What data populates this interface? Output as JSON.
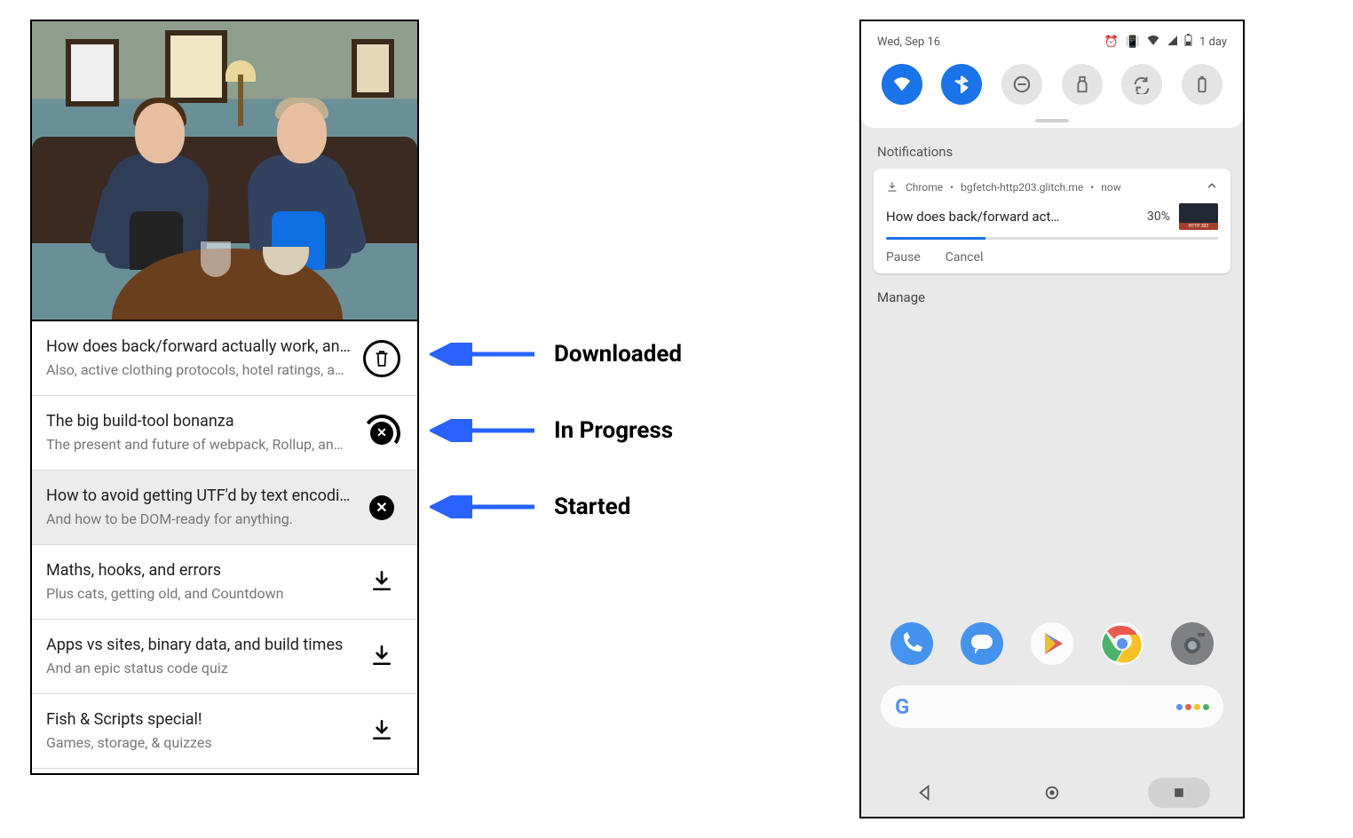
{
  "annotations": {
    "downloaded": "Downloaded",
    "in_progress": "In Progress",
    "started": "Started"
  },
  "episodes": [
    {
      "title": "How does back/forward actually work, an…",
      "subtitle": "Also, active clothing protocols, hotel ratings, a…",
      "state": "downloaded",
      "highlight": false
    },
    {
      "title": "The big build-tool bonanza",
      "subtitle": "The present and future of webpack, Rollup, an…",
      "state": "in_progress",
      "highlight": false
    },
    {
      "title": "How to avoid getting UTF'd by text encodi…",
      "subtitle": "And how to be DOM-ready for anything.",
      "state": "started",
      "highlight": true
    },
    {
      "title": "Maths, hooks, and errors",
      "subtitle": "Plus cats, getting old, and Countdown",
      "state": "idle",
      "highlight": false
    },
    {
      "title": "Apps vs sites, binary data, and build times",
      "subtitle": "And an epic status code quiz",
      "state": "idle",
      "highlight": false
    },
    {
      "title": "Fish & Scripts special!",
      "subtitle": "Games, storage, & quizzes",
      "state": "idle",
      "highlight": false
    }
  ],
  "android": {
    "status": {
      "date": "Wed, Sep 16",
      "alarm_icon": "alarm",
      "vibrate_icon": "vibrate",
      "wifi_icon": "wifi-full",
      "signal_icon": "signal-full",
      "battery_icon": "battery",
      "battery_text": "1 day"
    },
    "quick_settings": [
      {
        "name": "wifi",
        "on": true
      },
      {
        "name": "bluetooth",
        "on": true
      },
      {
        "name": "dnd",
        "on": false
      },
      {
        "name": "flashlight",
        "on": false
      },
      {
        "name": "autorotate",
        "on": false
      },
      {
        "name": "battery",
        "on": false
      }
    ],
    "section_label": "Notifications",
    "notification": {
      "app": "Chrome",
      "source": "bgfetch-http203.glitch.me",
      "when": "now",
      "title": "How does back/forward act…",
      "percent_text": "30%",
      "percent_value": 30,
      "actions": {
        "pause": "Pause",
        "cancel": "Cancel"
      }
    },
    "manage_label": "Manage",
    "search_placeholder": "",
    "navbar": {
      "back": "back",
      "home": "home",
      "recents": "recents"
    }
  }
}
